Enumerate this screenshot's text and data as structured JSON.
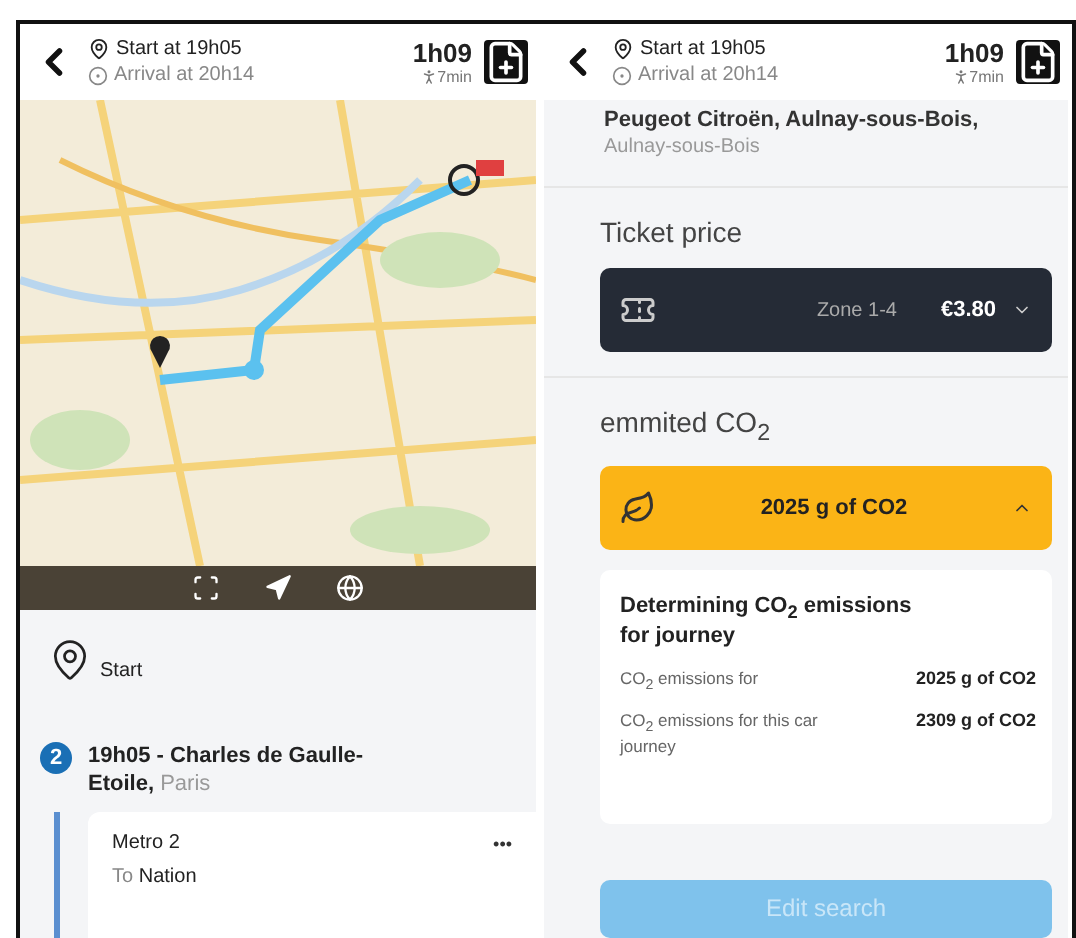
{
  "left": {
    "header": {
      "start": "Start at 19h05",
      "arrival": "Arrival at 20h14",
      "duration": "1h09",
      "walk": "7min"
    },
    "start_label": "Start",
    "step": {
      "number": "2",
      "title": "19h05 - Charles de Gaulle-Etoile,",
      "place": "Paris"
    },
    "leg": {
      "line": "Metro 2",
      "direction_prefix": "To",
      "direction": "Nation",
      "more": "•••"
    }
  },
  "right": {
    "header": {
      "start": "Start at 19h05",
      "arrival": "Arrival at 20h14",
      "duration": "1h09",
      "walk": "7min"
    },
    "destination": {
      "title": "Peugeot Citroën, Aulnay-sous-Bois,",
      "place": "Aulnay-sous-Bois"
    },
    "ticket": {
      "heading": "Ticket price",
      "zone": "Zone 1-4",
      "price": "€3.80",
      "expanded": false
    },
    "co2": {
      "heading": "emmited CO$_{2}$",
      "total": "2025 g of CO2",
      "expanded": true,
      "detail_title": "Determining CO$_{2}$ emissions for journey",
      "rows": [
        {
          "label": "CO$_{2}$ emissions for",
          "value": "2025 g of CO2"
        },
        {
          "label": "CO$_{2}$ emissions for this car journey",
          "value": "2309 g of CO2"
        }
      ]
    },
    "edit_button": {
      "label": "Edit search",
      "disabled": true
    }
  }
}
